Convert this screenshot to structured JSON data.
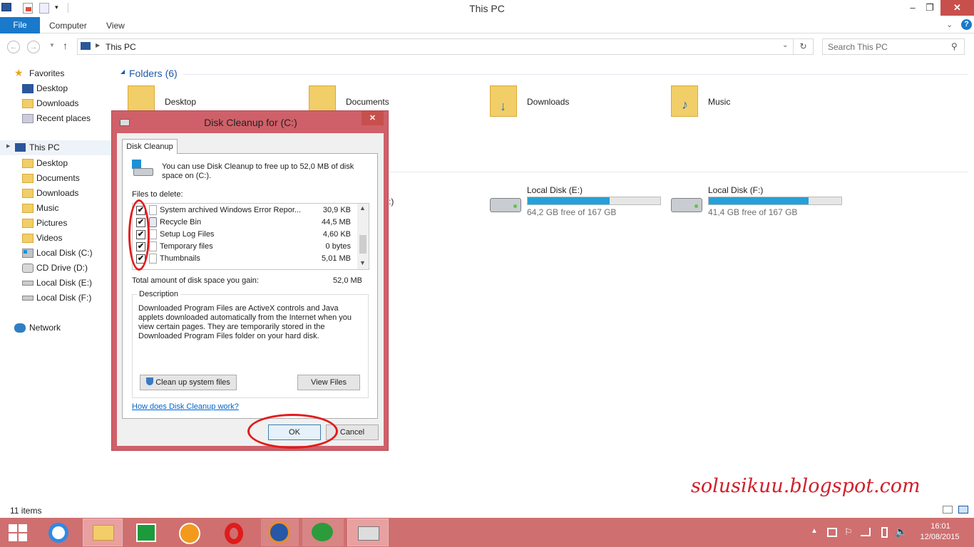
{
  "window": {
    "title": "This PC",
    "min": "–",
    "max": "❐",
    "close": "✕"
  },
  "ribbon": {
    "file": "File",
    "computer": "Computer",
    "view": "View"
  },
  "address": {
    "path": "This PC",
    "search_placeholder": "Search This PC"
  },
  "nav": {
    "favorites": "Favorites",
    "fav_items": [
      "Desktop",
      "Downloads",
      "Recent places"
    ],
    "this_pc": "This PC",
    "pc_items": [
      "Desktop",
      "Documents",
      "Downloads",
      "Music",
      "Pictures",
      "Videos",
      "Local Disk (C:)",
      "CD Drive (D:)",
      "Local Disk (E:)",
      "Local Disk (F:)"
    ],
    "network": "Network"
  },
  "main": {
    "folders_header": "Folders (6)",
    "folders": [
      "Desktop",
      "Documents",
      "Downloads",
      "Music"
    ],
    "partial_drive_label": ":)",
    "drives": [
      {
        "name": "Local Disk (E:)",
        "free": "64,2 GB free of 167 GB",
        "used_fraction": 0.62
      },
      {
        "name": "Local Disk (F:)",
        "free": "41,4 GB free of 167 GB",
        "used_fraction": 0.75
      }
    ]
  },
  "status": {
    "items": "11 items"
  },
  "dialog": {
    "title": "Disk Cleanup for  (C:)",
    "close": "✕",
    "tab": "Disk Cleanup",
    "intro": "You can use Disk Cleanup to free up to 52,0 MB of disk space on  (C:).",
    "files_label": "Files to delete:",
    "files": [
      {
        "name": "System archived Windows Error Repor...",
        "size": "30,9 KB",
        "checked": true
      },
      {
        "name": "Recycle Bin",
        "size": "44,5 MB",
        "checked": true
      },
      {
        "name": "Setup Log Files",
        "size": "4,60 KB",
        "checked": true
      },
      {
        "name": "Temporary files",
        "size": "0 bytes",
        "checked": true
      },
      {
        "name": "Thumbnails",
        "size": "5,01 MB",
        "checked": true
      }
    ],
    "total_label": "Total amount of disk space you gain:",
    "total_value": "52,0 MB",
    "description_label": "Description",
    "description": "Downloaded Program Files are ActiveX controls and Java applets downloaded automatically from the Internet when you view certain pages. They are temporarily stored in the Downloaded Program Files folder on your hard disk.",
    "cleanup_system": "Clean up system files",
    "view_files": "View Files",
    "help_link": "How does Disk Cleanup work?",
    "ok": "OK",
    "cancel": "Cancel"
  },
  "watermark": "solusikuu.blogspot.com",
  "tray": {
    "time": "16:01",
    "date": "12/08/2015"
  },
  "colors": {
    "taskbar": "#cf6f70",
    "file_tab": "#1979ca",
    "dialog_frame": "#cf6069",
    "annotation_red": "#e31a1c",
    "disk_fill": "#26a0da"
  }
}
